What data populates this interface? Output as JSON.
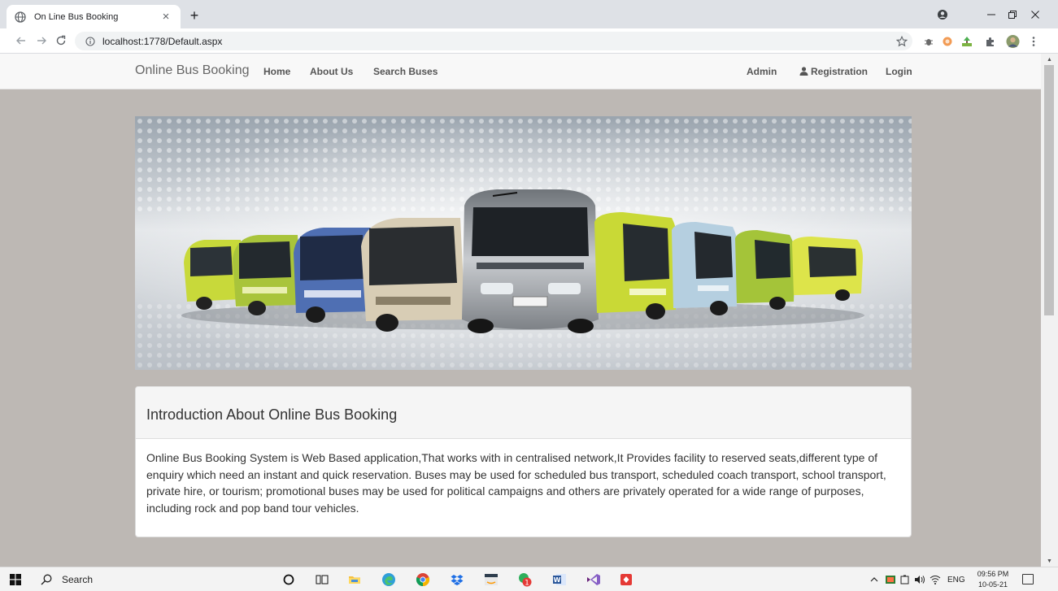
{
  "browser": {
    "tab_title": "On Line Bus Booking",
    "tab_close": "×",
    "new_tab": "+",
    "url": "localhost:1778/Default.aspx"
  },
  "site": {
    "brand": "Online Bus Booking",
    "nav_left": [
      "Home",
      "About Us",
      "Search Buses"
    ],
    "nav_right": {
      "admin": "Admin",
      "registration": "Registration",
      "login": "Login"
    }
  },
  "intro": {
    "heading": "Introduction About Online Bus Booking",
    "body": "Online Bus Booking System is Web Based application,That works with in centralised network,It Provides facility to reserved seats,different type of enquiry which need an instant and quick reservation. Buses may be used for scheduled bus transport, scheduled coach transport, school transport, private hire, or tourism; promotional buses may be used for political campaigns and others are privately operated for a wide range of purposes, including rock and pop band tour vehicles."
  },
  "taskbar": {
    "search_label": "Search",
    "lang": "ENG",
    "time": "09:56 PM",
    "date": "10-05-21"
  }
}
